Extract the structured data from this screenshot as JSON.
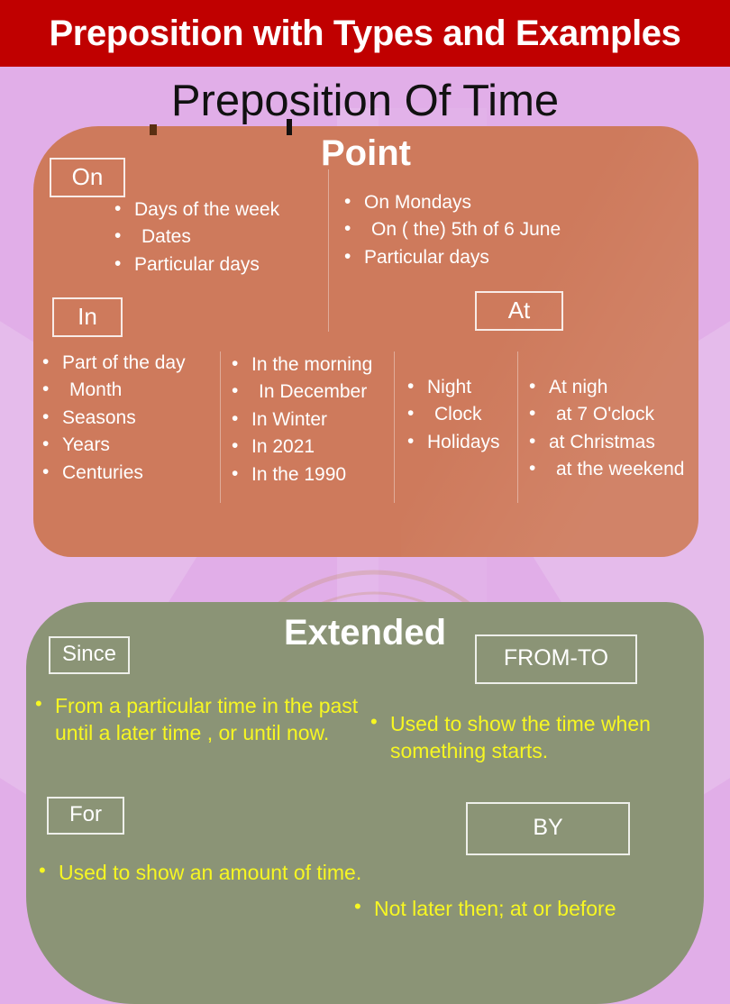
{
  "header": {
    "title": "Preposition with Types and Examples",
    "bar_color": "#C00000"
  },
  "page_title": "Preposition Of Time",
  "background_color": "#E1AEE8",
  "point_section": {
    "heading": "Point",
    "card_color": "#CE7A5C",
    "groups": [
      {
        "label": "On",
        "uses": [
          "Days of the week",
          "Dates",
          "Particular days"
        ],
        "examples": [
          "On Mondays",
          "On ( the) 5th of 6 June",
          "Particular days"
        ]
      },
      {
        "label": "In",
        "uses": [
          "Part of the day",
          "Month",
          "Seasons",
          "Years",
          "Centuries"
        ],
        "examples": [
          "In the morning",
          "In December",
          "In Winter",
          "In 2021",
          "In the 1990"
        ]
      },
      {
        "label": "At",
        "uses": [
          "Night",
          "Clock",
          "Holidays"
        ],
        "examples": [
          "At nigh",
          "at 7 O'clock",
          "at Christmas",
          "at the weekend"
        ]
      }
    ]
  },
  "extended_section": {
    "heading": "Extended",
    "card_color": "#8B9476",
    "text_color": "#F7F722",
    "groups": [
      {
        "label": "Since",
        "definition": "From a particular time in the past until a later time , or until now."
      },
      {
        "label": "FROM-TO",
        "definition": "Used to show the time when something starts."
      },
      {
        "label": "For",
        "definition": "Used to show an amount of time."
      },
      {
        "label": "BY",
        "definition": "Not later then; at or before"
      }
    ]
  }
}
